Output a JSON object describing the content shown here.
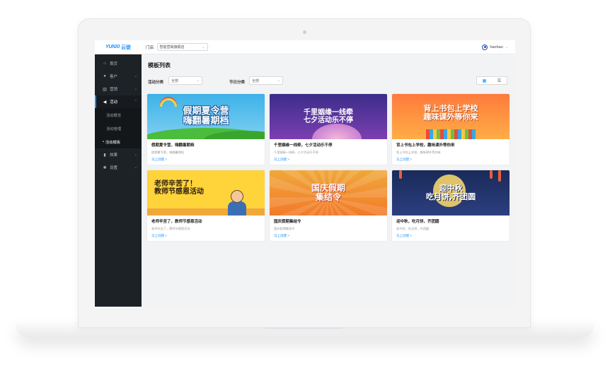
{
  "header": {
    "logo_mark": "YUNXI",
    "logo_text": "云徙",
    "store_label": "门店:",
    "store_value": "智能营销旗舰店",
    "username": "haohao"
  },
  "sidebar": {
    "items": [
      {
        "label": "首页",
        "icon": "home-icon"
      },
      {
        "label": "客户",
        "icon": "user-icon"
      },
      {
        "label": "营销",
        "icon": "chart-icon"
      },
      {
        "label": "活动",
        "icon": "megaphone-icon"
      },
      {
        "label": "效果",
        "icon": "bar-chart-icon"
      },
      {
        "label": "设置",
        "icon": "gear-icon"
      }
    ],
    "sub_items": [
      "活动概览",
      "活动管理",
      "活动模板"
    ]
  },
  "main": {
    "page_title": "模板列表",
    "filter_activity_label": "活动分类",
    "filter_activity_value": "全部",
    "filter_festival_label": "节日分类",
    "filter_festival_value": "全部"
  },
  "cards": [
    {
      "banner": "假期夏令营\n嗨翻暑期档",
      "title": "假期夏令营，嗨翻暑期档",
      "desc": "假期夏令营，嗨翻暑期档",
      "link": "马上创建 >"
    },
    {
      "banner": "千里姻缘一线牵\n七夕活动乐不停",
      "title": "千里姻缘一线牵，七夕活动乐不停",
      "desc": "千里姻缘一线牵，七夕活动乐不停",
      "link": "马上创建 >"
    },
    {
      "banner": "背上书包上学校\n趣味课外等你来",
      "title": "背上书包上学校，趣味课外等你来",
      "desc": "背上书包上学校，趣味课外等你来",
      "link": "马上创建 >"
    },
    {
      "banner": "老师辛苦了！\n教师节感恩活动",
      "title": "老师辛苦了，教师节感恩活动",
      "desc": "老师辛苦了，教师节感恩活动",
      "link": "马上创建 >"
    },
    {
      "banner": "国庆假期\n集结令",
      "title": "国庆假期集结令",
      "desc": "国庆假期集结令",
      "link": "马上创建 >"
    },
    {
      "banner": "迎中秋\n吃月饼,齐团圆",
      "title": "迎中秋，吃月饼，齐团圆",
      "desc": "迎中秋，吃月饼，齐团圆",
      "link": "马上创建 >"
    }
  ],
  "colors": {
    "sidebar_bg": "#1d2227",
    "accent": "#1890ff"
  }
}
